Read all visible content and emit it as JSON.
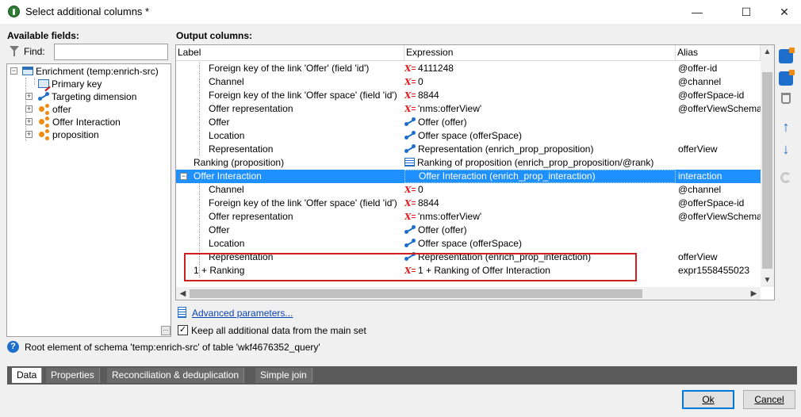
{
  "window": {
    "title": "Select additional columns *",
    "minimize": "—",
    "maximize": "☐",
    "close": "✕"
  },
  "left": {
    "heading": "Available fields:",
    "find_label": "Find:",
    "find_value": "",
    "tree": [
      {
        "label": "Enrichment (temp:enrich-src)",
        "icon": "table-icon",
        "expander": "−"
      },
      {
        "label": "Primary key",
        "icon": "key-icon"
      },
      {
        "label": "Targeting dimension",
        "icon": "link-icon",
        "expander": "+"
      },
      {
        "label": "offer",
        "icon": "org-link-icon",
        "expander": "+"
      },
      {
        "label": "Offer Interaction",
        "icon": "org-link-icon",
        "expander": "+"
      },
      {
        "label": "proposition",
        "icon": "org-link-icon",
        "expander": "+"
      }
    ],
    "corner_button": "⋯"
  },
  "grid": {
    "heading": "Output columns:",
    "columns": [
      "Label",
      "Expression",
      "Alias"
    ],
    "rows": [
      {
        "label": "Foreign key of the link 'Offer' (field 'id')",
        "expr_icon": "expression-x-icon",
        "expression": "4111248",
        "alias": "@offer-id"
      },
      {
        "label": "Channel",
        "expr_icon": "expression-x-icon",
        "expression": "0",
        "alias": "@channel"
      },
      {
        "label": "Foreign key of the link 'Offer space' (field 'id')",
        "expr_icon": "expression-x-icon",
        "expression": "8844",
        "alias": "@offerSpace-id"
      },
      {
        "label": "Offer representation",
        "expr_icon": "expression-x-icon",
        "expression": "'nms:offerView'",
        "alias": "@offerViewSchema"
      },
      {
        "label": "Offer",
        "expr_icon": "link-icon",
        "expression": "Offer (offer)",
        "alias": ""
      },
      {
        "label": "Location",
        "expr_icon": "link-icon",
        "expression": "Offer space (offerSpace)",
        "alias": ""
      },
      {
        "label": "Representation",
        "expr_icon": "link-icon",
        "expression": "Representation (enrich_prop_proposition)",
        "alias": "offerView"
      },
      {
        "label": "Ranking (proposition)",
        "expr_icon": "list-icon",
        "expression": "Ranking of proposition (enrich_prop_proposition/@rank)",
        "alias": ""
      },
      {
        "label": "Offer Interaction",
        "expr_icon": "",
        "expression": "Offer Interaction (enrich_prop_interaction)",
        "alias": "interaction"
      },
      {
        "label": "Channel",
        "expr_icon": "expression-x-icon",
        "expression": "0",
        "alias": "@channel"
      },
      {
        "label": "Foreign key of the link 'Offer space' (field 'id')",
        "expr_icon": "expression-x-icon",
        "expression": "8844",
        "alias": "@offerSpace-id"
      },
      {
        "label": "Offer representation",
        "expr_icon": "expression-x-icon",
        "expression": "'nms:offerView'",
        "alias": "@offerViewSchema"
      },
      {
        "label": "Offer",
        "expr_icon": "link-icon",
        "expression": "Offer (offer)",
        "alias": ""
      },
      {
        "label": "Location",
        "expr_icon": "link-icon",
        "expression": "Offer space (offerSpace)",
        "alias": ""
      },
      {
        "label": "Representation",
        "expr_icon": "link-icon",
        "expression": "Representation (enrich_prop_interaction)",
        "alias": "offerView"
      },
      {
        "label": "1 + Ranking",
        "expr_icon": "expression-x-icon",
        "expression": "1 + Ranking of Offer Interaction",
        "alias": "expr1558455023"
      }
    ],
    "selected_row": 8,
    "collapse_glyph": "−"
  },
  "toolbar": {
    "up_arrow": "↑",
    "down_arrow": "↓"
  },
  "bottom": {
    "advanced_link": "Advanced parameters...",
    "keep_label": "Keep all additional data from the main set",
    "keep_checked": "✓",
    "help_glyph": "?",
    "status": "Root element of schema 'temp:enrich-src' of table 'wkf4676352_query'",
    "tabs": [
      "Data",
      "Properties",
      "Reconciliation & deduplication",
      "Simple join"
    ],
    "ok": "Ok",
    "cancel": "Cancel"
  }
}
